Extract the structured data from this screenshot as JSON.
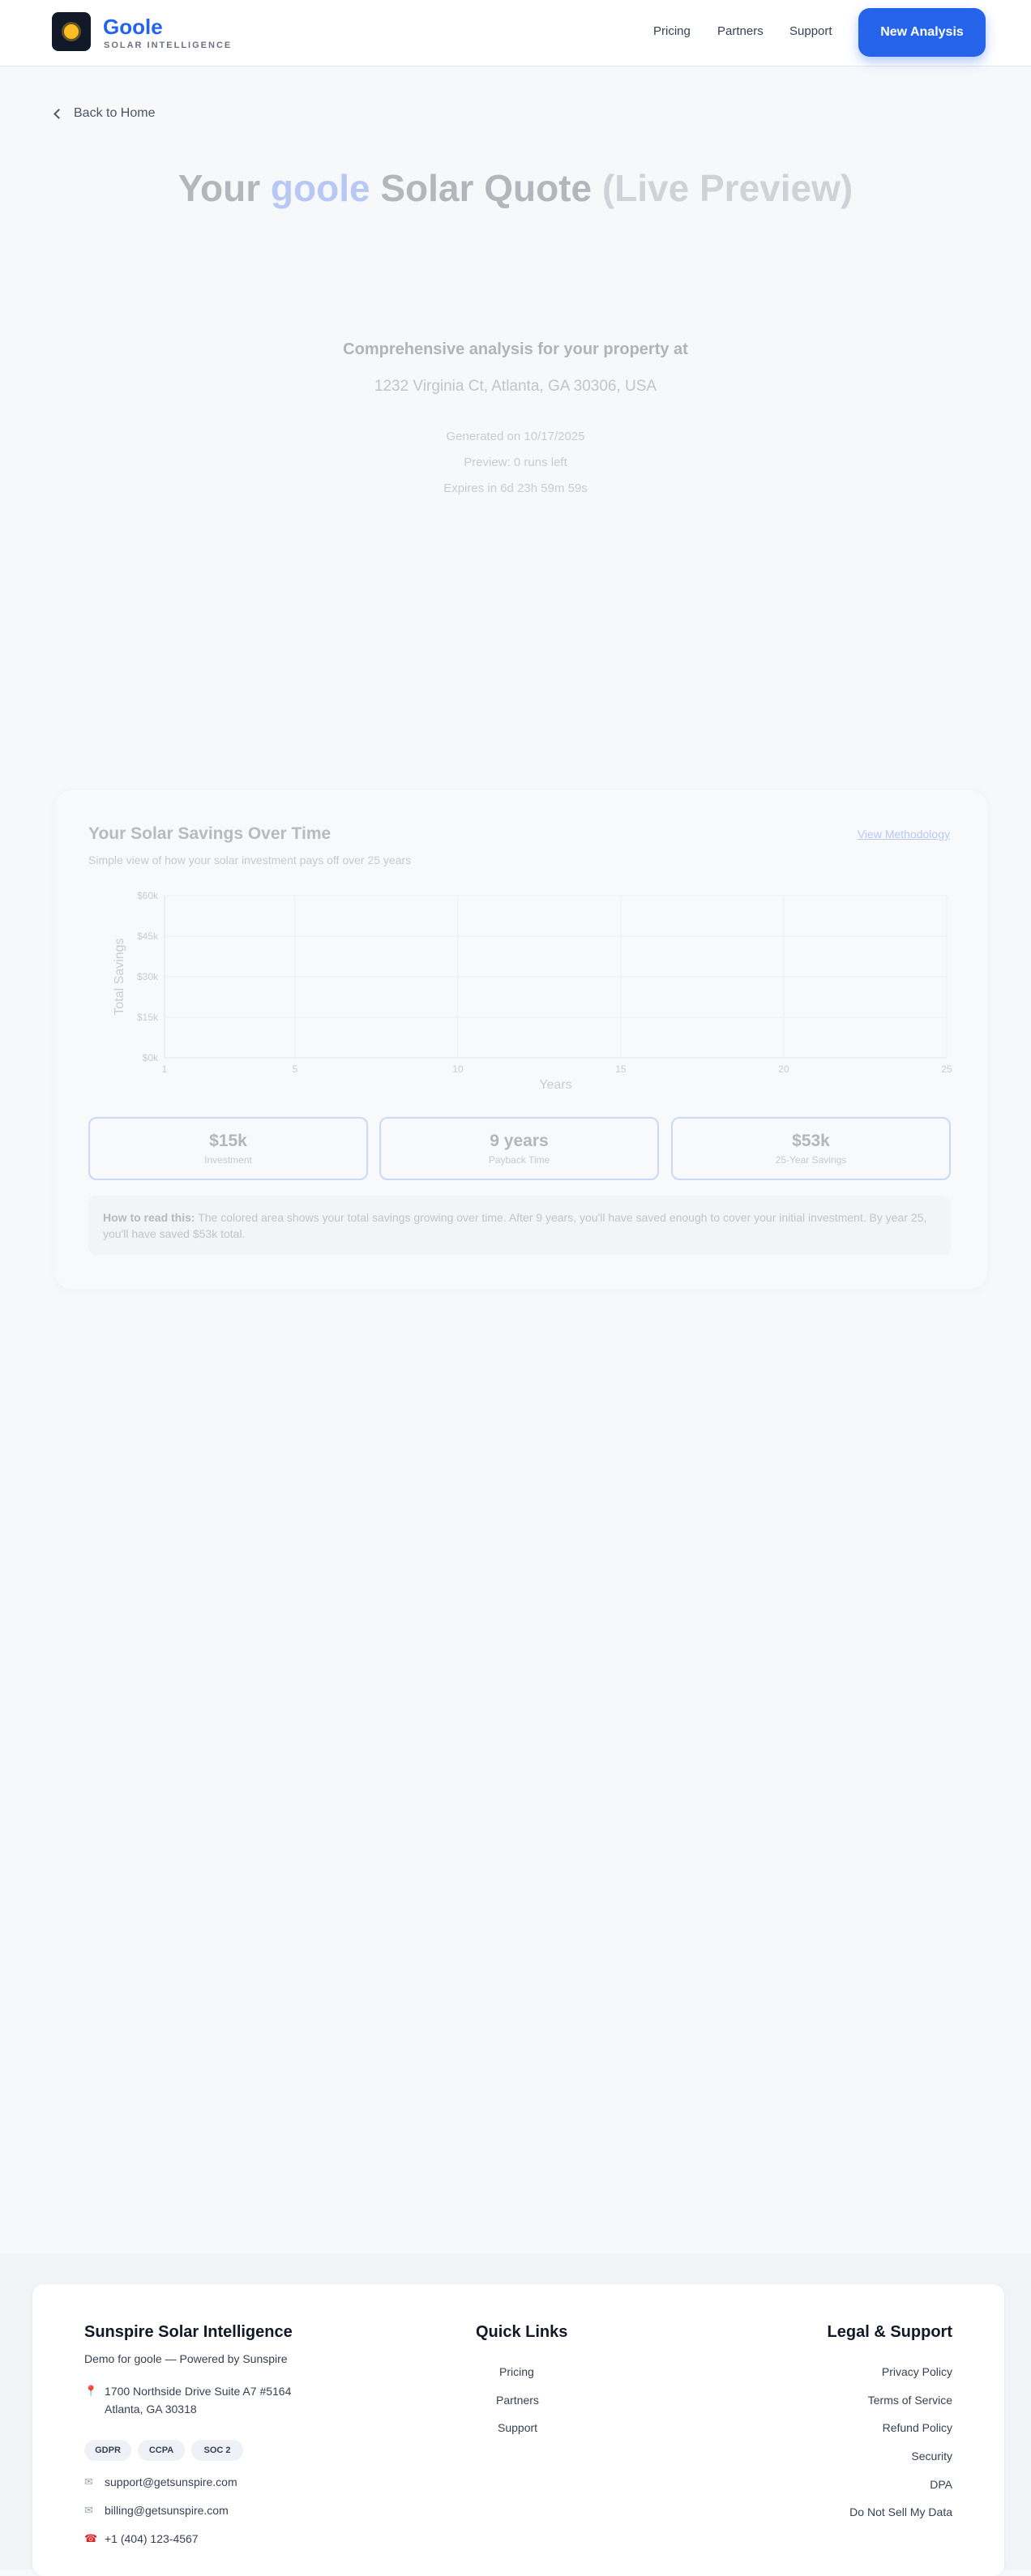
{
  "header": {
    "brand_name": "Goole",
    "brand_sub": "SOLAR INTELLIGENCE",
    "logo_icon": "sun-icon",
    "nav": [
      "Pricing",
      "Partners",
      "Support"
    ],
    "cta": "New Analysis",
    "accent": "#2563eb"
  },
  "back": {
    "label": "Back to Home"
  },
  "hero": {
    "title_prefix": "Your ",
    "title_brand": "goole",
    "title_mid": " Solar Quote ",
    "title_live": "(Live Preview)",
    "subhead": "Comprehensive analysis for your property at",
    "address": "1232 Virginia Ct, Atlanta, GA 30306, USA",
    "generated": "Generated on 10/17/2025",
    "preview": "Preview: 0 runs left",
    "expires": "Expires in 6d 23h 59m 59s"
  },
  "savings": {
    "title": "Your Solar Savings Over Time",
    "subtitle": "Simple view of how your solar investment pays off over 25 years",
    "methodology": "View Methodology",
    "stats": [
      {
        "value": "$15k",
        "label": "Investment"
      },
      {
        "value": "9 years",
        "label": "Payback Time"
      },
      {
        "value": "$53k",
        "label": "25-Year Savings"
      }
    ],
    "howto_label": "How to read this:",
    "howto_text": " The colored area shows your total savings growing over time. After 9 years, you'll have saved enough to cover your initial investment. By year 25, you'll have saved $53k total."
  },
  "chart_data": {
    "type": "area",
    "xlabel": "Years",
    "ylabel": "Total Savings",
    "x_ticks": [
      "1",
      "5",
      "10",
      "15",
      "20",
      "25"
    ],
    "y_ticks": [
      "$0k",
      "$15k",
      "$30k",
      "$45k",
      "$60k"
    ],
    "xlim": [
      1,
      25
    ],
    "ylim": [
      0,
      60
    ],
    "grid": true,
    "series": []
  },
  "footer": {
    "company": "Sunspire Solar Intelligence",
    "tagline": "Demo for goole — Powered by Sunspire",
    "address_line1": "1700 Northside Drive Suite A7 #5164",
    "address_line2": "Atlanta, GA 30318",
    "badges": [
      "GDPR",
      "CCPA",
      "SOC 2"
    ],
    "email_support": "support@getsunspire.com",
    "email_billing": "billing@getsunspire.com",
    "phone": "+1 (404) 123-4567",
    "quick_title": "Quick Links",
    "quick_links": [
      "Pricing",
      "Partners",
      "Support"
    ],
    "legal_title": "Legal & Support",
    "legal_links": [
      "Privacy Policy",
      "Terms of Service",
      "Refund Policy",
      "Security",
      "DPA",
      "Do Not Sell My Data"
    ]
  }
}
